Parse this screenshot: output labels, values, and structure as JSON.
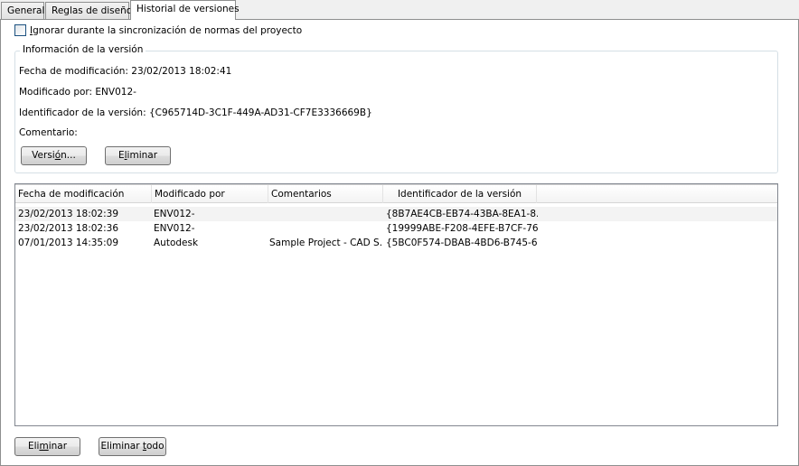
{
  "tabs": [
    {
      "label": "General"
    },
    {
      "label": "Reglas de diseño"
    },
    {
      "label": "Historial de versiones"
    }
  ],
  "sync_checkbox": {
    "label_first": "I",
    "label_rest": "gnorar durante la sincronización de normas del proyecto",
    "checked": false
  },
  "version_info": {
    "group_title": "Información de la versión",
    "modified_date": "Fecha de modificación: 23/02/2013 18:02:41",
    "modified_by": "Modificado por: ENV012-",
    "version_id": "Identificador de la versión: {C965714D-3C1F-449A-AD31-CF7E3336669B}",
    "comment": "Comentario:",
    "version_button": {
      "pre": "Versi",
      "mn": "ó",
      "post": "n..."
    },
    "delete_button": {
      "pre": "E",
      "mn": "l",
      "post": "iminar"
    }
  },
  "history_table": {
    "columns": [
      "Fecha de modificación",
      "Modificado por",
      "Comentarios",
      "Identificador de la versión"
    ],
    "rows": [
      [
        "23/02/2013 18:02:39",
        "ENV012-",
        "",
        "{8B7AE4CB-EB74-43BA-8EA1-8..."
      ],
      [
        "23/02/2013 18:02:36",
        "ENV012-",
        "",
        "{19999ABE-F208-4EFE-B7CF-76..."
      ],
      [
        "07/01/2013 14:35:09",
        "Autodesk",
        "Sample Project - CAD S...",
        "{5BC0F574-DBAB-4BD6-B745-6..."
      ]
    ]
  },
  "footer": {
    "delete_button": {
      "pre": "Eli",
      "mn": "m",
      "post": "inar"
    },
    "delete_all_button": {
      "pre": "Eliminar ",
      "mn": "t",
      "post": "odo"
    }
  },
  "colors": {
    "selected_row": "#f3f3f3",
    "panel_border": "#8e8f8f",
    "checkbox_border": "#1c5180"
  }
}
